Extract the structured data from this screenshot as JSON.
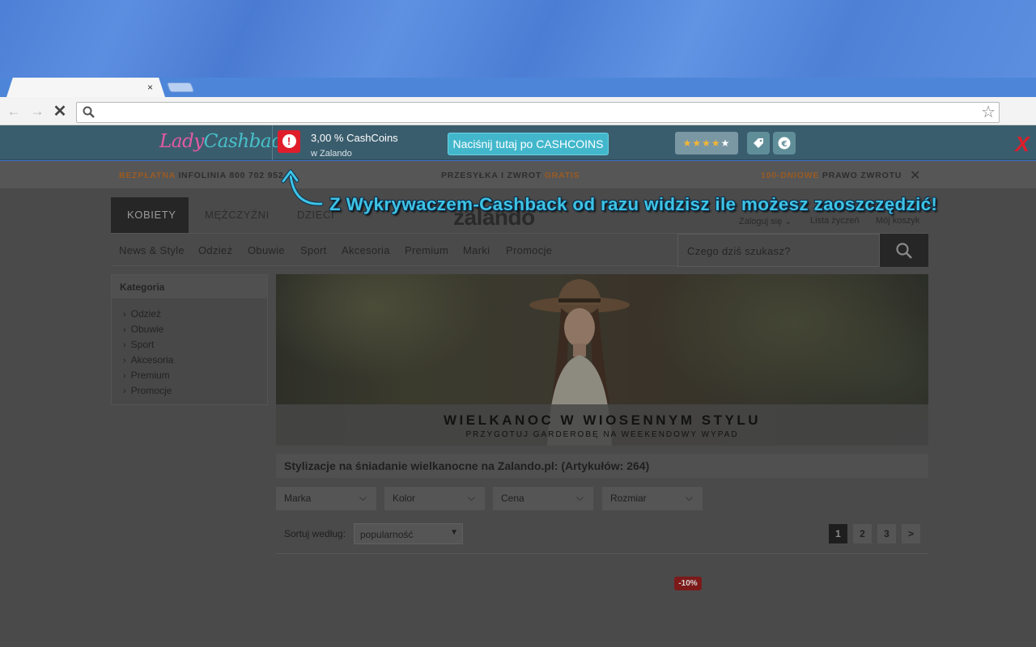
{
  "browser": {
    "tab_close": "×",
    "address_value": "",
    "nav": {
      "back": "←",
      "forward": "→",
      "stop": "✕"
    },
    "star": "☆"
  },
  "cashback": {
    "logo_lady": "Lady",
    "logo_cashback": "Cashback",
    "rate": "3,00 % CashCoins",
    "shop": "w Zalando",
    "cta_label": "Naciśnij tutaj po CASHCOINS",
    "rating": 3.5,
    "rating_max": 5,
    "close_label": "X",
    "alert_symbol": "!"
  },
  "site": {
    "info_bar": {
      "left_orange": "BEZPŁATNA",
      "left_rest": " INFOLINIA 800 702 952",
      "mid_rest": "PRZESYŁKA I ZWROT ",
      "mid_orange": "GRATIS",
      "right_orange": "100-DNIOWE",
      "right_rest": " PRAWO ZWROTU",
      "close": "✕"
    },
    "gender_tabs": [
      "KOBIETY",
      "MĘŻCZYŹNI",
      "DZIECI"
    ],
    "brand": "zalando",
    "account_links": [
      "Zaloguj się",
      "Lista życzeń",
      "Mój koszyk"
    ],
    "categories": [
      "News & Style",
      "Odzież",
      "Obuwie",
      "Sport",
      "Akcesoria",
      "Premium",
      "Marki",
      "Promocje"
    ],
    "search_placeholder": "Czego dziś szukasz?",
    "sidebar": {
      "title": "Kategoria",
      "items": [
        "Odzież",
        "Obuwie",
        "Sport",
        "Akcesoria",
        "Premium",
        "Promocje"
      ]
    },
    "banner": {
      "title": "WIELKANOC W WIOSENNYM STYLU",
      "subtitle": "PRZYGOTUJ GARDEROBĘ NA WEEKENDOWY WYPAD"
    },
    "result_heading": "Stylizacje na śniadanie wielkanocne na Zalando.pl: (Artykułów: 264)",
    "filters": [
      "Marka",
      "Kolor",
      "Cena",
      "Rozmiar"
    ],
    "sort_label": "Sortuj według:",
    "sort_value": "popularność",
    "pages": [
      "1",
      "2",
      "3",
      ">"
    ],
    "sale_badge": "-10%"
  },
  "overlay": {
    "hint": "Z Wykrywaczem-Cashback od razu widzisz ile możesz zaoszczędzić!"
  },
  "colors": {
    "cashback_bar": "#3a5d6d",
    "cta": "#42b7cc",
    "alert": "#e01d2a",
    "hint_text": "#3ec3e4"
  }
}
